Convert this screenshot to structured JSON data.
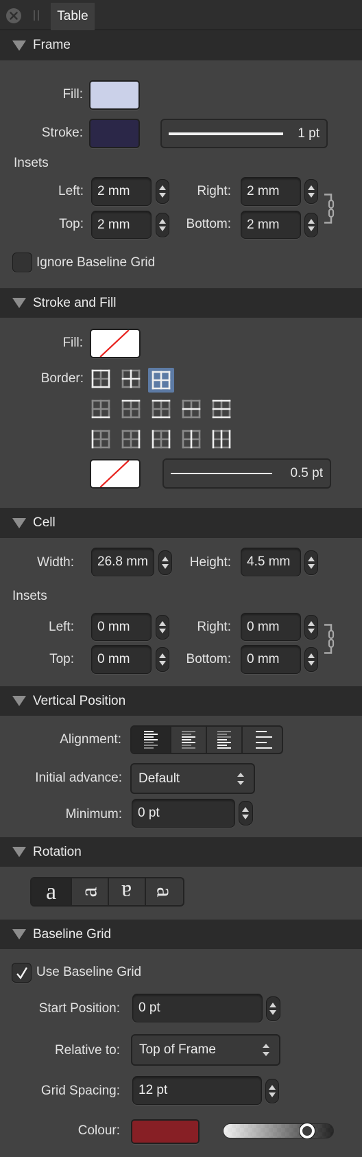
{
  "tab_bar": {
    "tab_label": "Table"
  },
  "frame": {
    "title": "Frame",
    "fill_label": "Fill:",
    "fill_color": "#cbd1e9",
    "stroke_label": "Stroke:",
    "stroke_color": "#2b2748",
    "stroke_width": "1 pt",
    "insets_label": "Insets",
    "left_label": "Left:",
    "left_value": "2 mm",
    "right_label": "Right:",
    "right_value": "2 mm",
    "top_label": "Top:",
    "top_value": "2 mm",
    "bottom_label": "Bottom:",
    "bottom_value": "2 mm",
    "insets_linked": true,
    "ignore_baseline_label": "Ignore Baseline Grid",
    "ignore_baseline_checked": false
  },
  "stroke_and_fill": {
    "title": "Stroke and Fill",
    "fill_label": "Fill:",
    "fill_color": "none",
    "border_label": "Border:",
    "border_presets": [
      {
        "name": "outer",
        "edges": [
          "top",
          "bottom",
          "left",
          "right"
        ]
      },
      {
        "name": "inner",
        "edges": [
          "hmid",
          "vmid"
        ]
      },
      {
        "name": "all",
        "edges": [
          "top",
          "bottom",
          "left",
          "right",
          "hmid",
          "vmid"
        ]
      },
      {
        "name": "bottom",
        "edges": [
          "bottom"
        ]
      },
      {
        "name": "top",
        "edges": [
          "top"
        ]
      },
      {
        "name": "top-bottom",
        "edges": [
          "top",
          "bottom"
        ]
      },
      {
        "name": "horizontal-inner",
        "edges": [
          "hmid"
        ]
      },
      {
        "name": "horizontal-all",
        "edges": [
          "top",
          "hmid",
          "bottom"
        ]
      },
      {
        "name": "left",
        "edges": [
          "left"
        ]
      },
      {
        "name": "right",
        "edges": [
          "right"
        ]
      },
      {
        "name": "left-right",
        "edges": [
          "left",
          "right"
        ]
      },
      {
        "name": "vertical-inner",
        "edges": [
          "vmid"
        ]
      },
      {
        "name": "vertical-all",
        "edges": [
          "left",
          "vmid",
          "right"
        ]
      }
    ],
    "border_selected": 2,
    "stroke_color": "none",
    "stroke_width": "0.5 pt"
  },
  "cell": {
    "title": "Cell",
    "width_label": "Width:",
    "width_value": "26.8 mm",
    "height_label": "Height:",
    "height_value": "4.5 mm",
    "insets_label": "Insets",
    "left_label": "Left:",
    "left_value": "0 mm",
    "right_label": "Right:",
    "right_value": "0 mm",
    "top_label": "Top:",
    "top_value": "0 mm",
    "bottom_label": "Bottom:",
    "bottom_value": "0 mm",
    "insets_linked": true
  },
  "vertical_position": {
    "title": "Vertical Position",
    "alignment_label": "Alignment:",
    "alignment_options": [
      "top",
      "center",
      "bottom",
      "justify"
    ],
    "alignment_selected": 0,
    "initial_advance_label": "Initial advance:",
    "initial_advance_value": "Default",
    "minimum_label": "Minimum:",
    "minimum_value": "0 pt"
  },
  "rotation": {
    "title": "Rotation",
    "glyph": "a",
    "options": [
      "0°",
      "90°",
      "180°",
      "270°"
    ],
    "selected": 0
  },
  "baseline_grid": {
    "title": "Baseline Grid",
    "use_label": "Use Baseline Grid",
    "use_checked": true,
    "start_label": "Start Position:",
    "start_value": "0 pt",
    "relative_label": "Relative to:",
    "relative_value": "Top of Frame",
    "spacing_label": "Grid Spacing:",
    "spacing_value": "12 pt",
    "colour_label": "Colour:",
    "colour": "#871f25",
    "opacity": 0.79
  }
}
